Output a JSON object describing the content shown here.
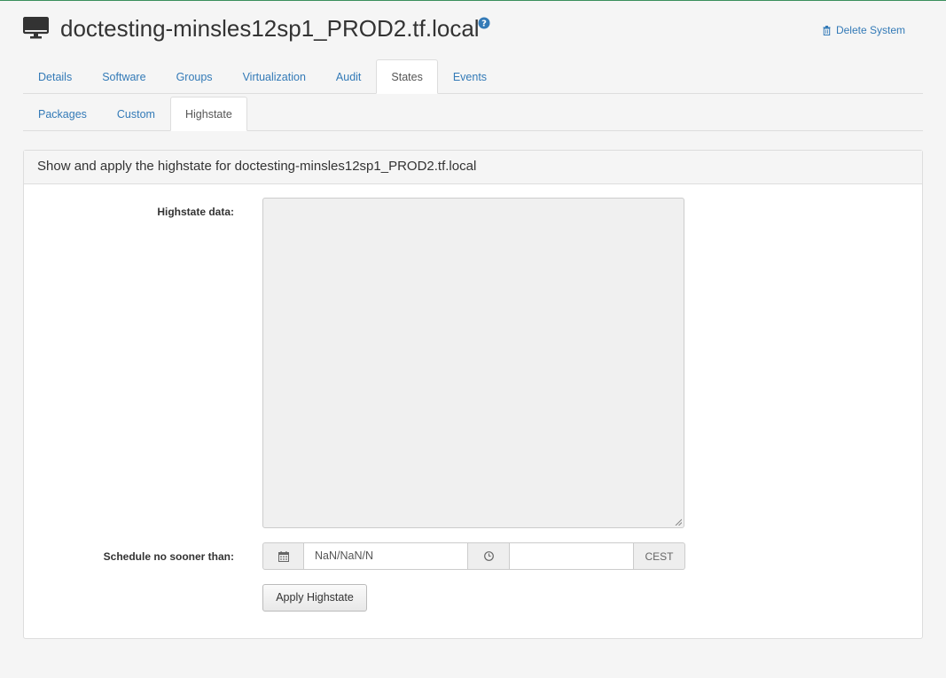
{
  "header": {
    "system_icon": "monitor-icon",
    "title": "doctesting-minsles12sp1_PROD2.tf.local",
    "help_icon": "question-circle-icon",
    "delete_label": "Delete System",
    "delete_icon": "trash-icon"
  },
  "primary_tabs": [
    {
      "label": "Details"
    },
    {
      "label": "Software"
    },
    {
      "label": "Groups"
    },
    {
      "label": "Virtualization"
    },
    {
      "label": "Audit"
    },
    {
      "label": "States",
      "active": true
    },
    {
      "label": "Events"
    }
  ],
  "secondary_tabs": [
    {
      "label": "Packages"
    },
    {
      "label": "Custom"
    },
    {
      "label": "Highstate",
      "active": true
    }
  ],
  "panel": {
    "heading": "Show and apply the highstate for doctesting-minsles12sp1_PROD2.tf.local",
    "highstate_label": "Highstate data:",
    "highstate_value": "",
    "schedule_label": "Schedule no sooner than:",
    "date_placeholder": "NaN/NaN/N",
    "time_value": "",
    "timezone": "CEST",
    "apply_label": "Apply Highstate"
  },
  "colors": {
    "link": "#337ab7",
    "accent_rule": "#3a8f5c"
  }
}
